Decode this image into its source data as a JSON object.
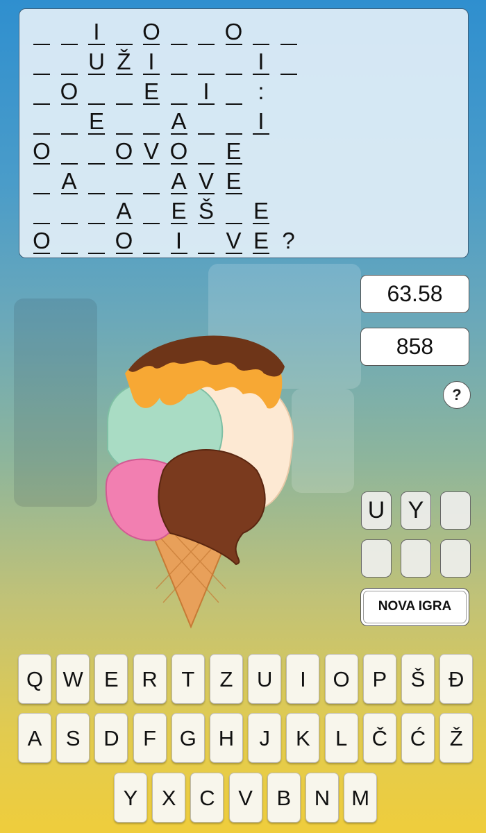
{
  "puzzle": {
    "rows": [
      [
        "_",
        "_",
        "I",
        "_",
        "O",
        "_",
        "_",
        "O",
        "_",
        "_"
      ],
      [
        "_",
        "_",
        "U",
        "Ž",
        "I",
        "_",
        "_",
        "_",
        "I",
        "_"
      ],
      [
        "_",
        "O",
        "_",
        "_",
        "E",
        "_",
        "I",
        "_",
        ":"
      ],
      [
        "_",
        "_",
        "E",
        "_",
        "_",
        "A",
        "_",
        "_",
        "I"
      ],
      [
        "O",
        "_",
        "_",
        "O",
        "V",
        "O",
        "_",
        "E"
      ],
      [
        "_",
        "A",
        "_",
        "_",
        "_",
        "A",
        "V",
        "E"
      ],
      [
        "_",
        "_",
        "_",
        "A",
        "_",
        "E",
        "Š",
        "_",
        "E"
      ],
      [
        "O",
        "_",
        "_",
        "O",
        "_",
        "I",
        "_",
        "V",
        "E",
        "?"
      ]
    ]
  },
  "score": {
    "time": "63.58",
    "points": "858"
  },
  "help_label": "?",
  "answer_slots": [
    "U",
    "Y",
    "",
    "",
    "",
    ""
  ],
  "new_game_label": "NOVA IGRA",
  "keyboard": {
    "row1": [
      "Q",
      "W",
      "E",
      "R",
      "T",
      "Z",
      "U",
      "I",
      "O",
      "P",
      "Š",
      "Đ"
    ],
    "row2": [
      "A",
      "S",
      "D",
      "F",
      "G",
      "H",
      "J",
      "K",
      "L",
      "Č",
      "Ć",
      "Ž"
    ],
    "row3": [
      "Y",
      "X",
      "C",
      "V",
      "B",
      "N",
      "M"
    ]
  },
  "colors": {
    "cone": "#e8a05a",
    "mint": "#a9dcc4",
    "pink": "#f27fb1",
    "chocolate": "#7a3a1e",
    "vanilla": "#fde9d3",
    "caramel": "#f7a834"
  }
}
